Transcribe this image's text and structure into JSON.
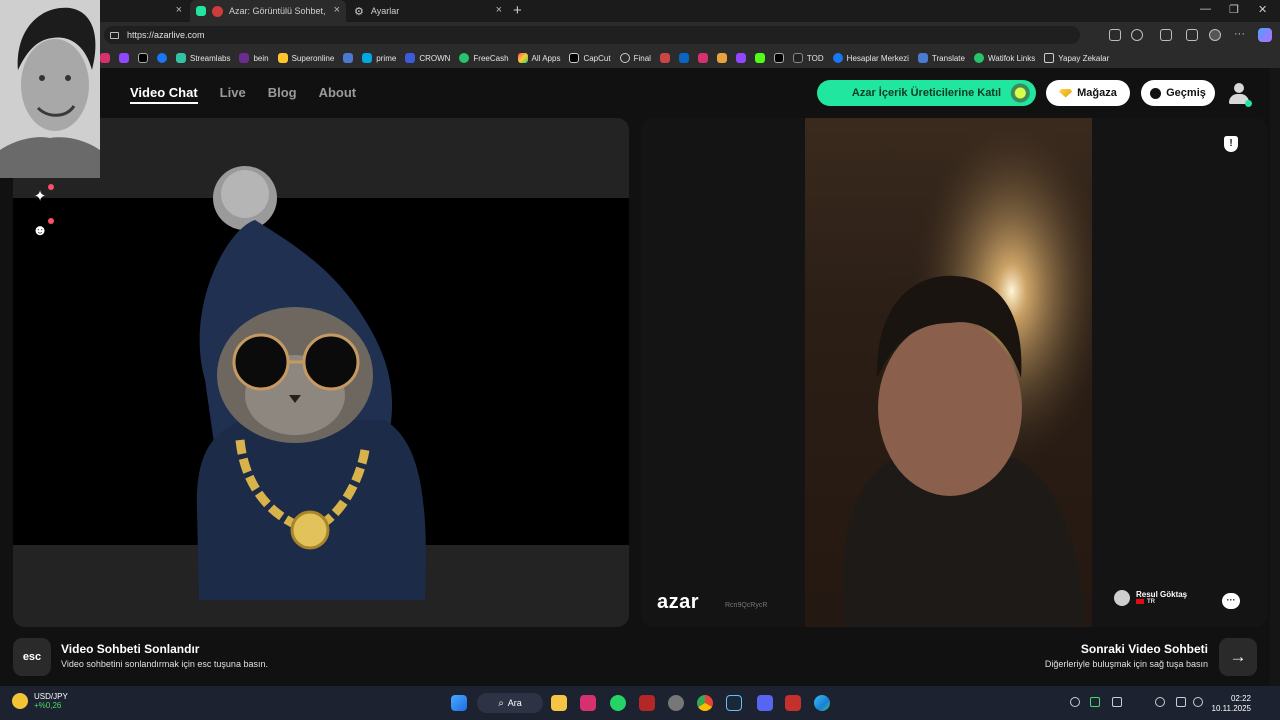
{
  "browser": {
    "tabs": [
      {
        "title": "Azar: Görüntülü Sohbet, Yeni",
        "active": true
      },
      {
        "title": "Ayarlar",
        "active": false
      }
    ],
    "url": "https://azarlive.com",
    "bookmarks": [
      "Streamlabs",
      "bein",
      "Superonline",
      "prime",
      "CROWN",
      "FreeCash",
      "All Apps",
      "CapCut",
      "Final",
      "TOD",
      "Hesaplar Merkezi",
      "Translate",
      "Watifok Links",
      "Yapay Zekalar"
    ]
  },
  "nav": {
    "video_chat": "Video Chat",
    "live": "Live",
    "blog": "Blog",
    "about": "About"
  },
  "header": {
    "creator_cta": "Azar İçerik Üreticilerine Katıl",
    "shop": "Mağaza",
    "history": "Geçmiş"
  },
  "remote": {
    "brand": "azar",
    "session_id": "Rcn9QcRycR",
    "name": "Resul Göktaş",
    "country": "TR"
  },
  "footer": {
    "esc_key": "esc",
    "end_title": "Video Sohbeti Sonlandır",
    "end_subtitle": "Video sohbetini sonlandırmak için esc tuşuna basın.",
    "next_title": "Sonraki Video Sohbeti",
    "next_subtitle": "Diğerleriyle buluşmak için sağ tuşa basın"
  },
  "taskbar": {
    "ticker_symbol": "USD/JPY",
    "ticker_change": "+%0,26",
    "search": "Ara",
    "time": "02:22",
    "date": "10.11.2025"
  },
  "colors": {
    "accent": "#21e6a0",
    "background": "#111111"
  }
}
